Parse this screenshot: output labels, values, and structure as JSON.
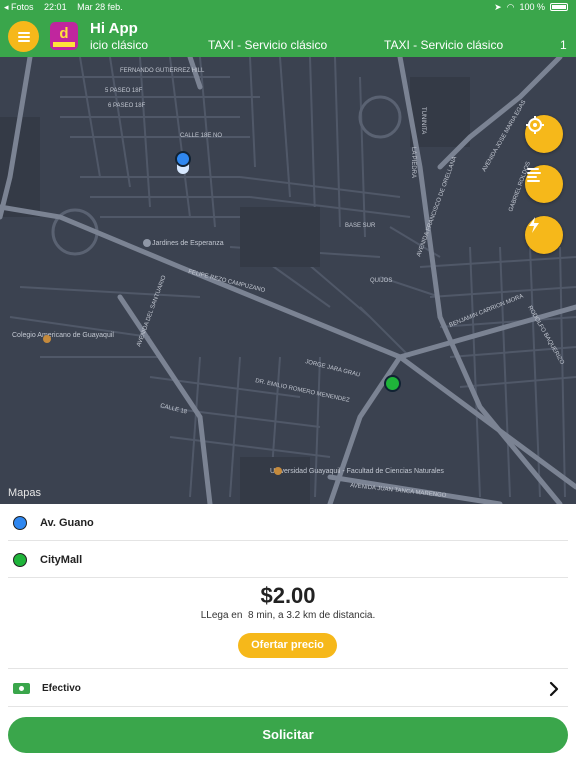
{
  "status_bar": {
    "back_app": "◂ Fotos",
    "time": "22:01",
    "date": "Mar 28 feb.",
    "battery": "100 %"
  },
  "header": {
    "title": "Hi App",
    "tabs": [
      "icio clásico",
      "TAXI - Servicio clásico",
      "TAXI - Servicio clásico",
      "1"
    ]
  },
  "map": {
    "attribution": "Mapas",
    "labels": [
      "FERNANDO GUTIERREZ HILL",
      "5 PASEO 18F",
      "6 PASEO 18F",
      "CALLE 18E NO",
      "Jardines de Esperanza",
      "FELIPE REZO CAMPUZANO",
      "AVENIDA DEL SANTUARIO",
      "Colegio Americano de Guayaquil",
      "JORGE JARA GRAU",
      "DR. EMILIO ROMERO MENENDEZ",
      "CALLE 18",
      "BASE SUR",
      "QUIJOS",
      "Universidad Guayaquil - Facultad de Ciencias Naturales",
      "AVENIDA JUAN TANCA MARENGO",
      "BENJAMIN CARRION MORA",
      "AVENIDA FRANCISCO DE ORELLANA",
      "LA PIEDRA",
      "RODOLFO BAQUERIZO",
      "AVENIDA JOSE MARIA EGAS",
      "GABRIEL ROLDOS",
      "TUNINITA"
    ]
  },
  "route": {
    "origin": "Av. Guano",
    "destination": "CityMall"
  },
  "fare": {
    "price": "$2.00",
    "eta": "LLega en  8 min, a 3.2 km de distancia.",
    "offer_label": "Ofertar precio"
  },
  "payment": {
    "method": "Efectivo"
  },
  "actions": {
    "request_label": "Solicitar"
  },
  "colors": {
    "brand_green": "#3aa64b",
    "accent_yellow": "#f6b81a",
    "map_bg": "#3b4250",
    "origin_pin": "#2f87f0",
    "destination_pin": "#1fb43a"
  },
  "icons": {
    "menu": "hamburger-icon",
    "locate": "crosshair-icon",
    "list": "list-icon",
    "quick": "bolt-icon",
    "cash": "cash-icon",
    "chevron": "chevron-right-icon"
  }
}
